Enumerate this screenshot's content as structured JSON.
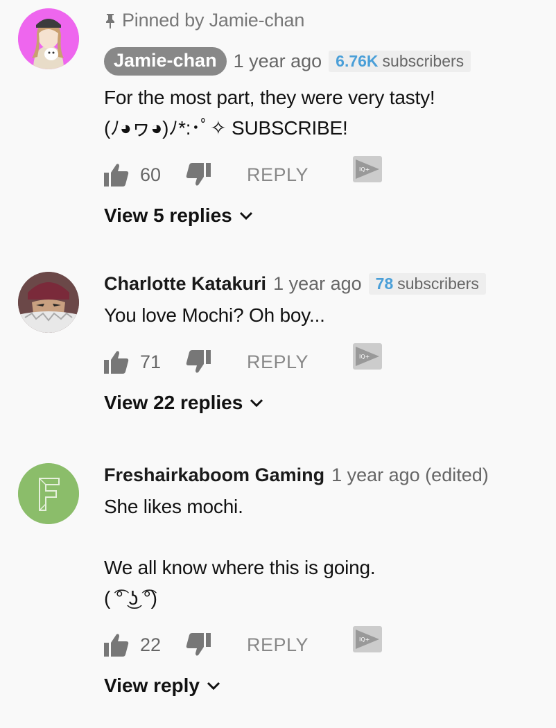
{
  "comments": [
    {
      "pinned_label": "Pinned by Jamie-chan",
      "author": "Jamie-chan",
      "time": "1 year ago",
      "subs_count": "6.76K",
      "subs_label": "subscribers",
      "lines": [
        "For the most part, they were very tasty!",
        "(ﾉ◕ヮ◕)ﾉ*:･ﾟ✧ SUBSCRIBE!"
      ],
      "likes": "60",
      "reply_label": "REPLY",
      "view_replies": "View 5 replies"
    },
    {
      "author": "Charlotte Katakuri",
      "time": "1 year ago",
      "subs_count": "78",
      "subs_label": "subscribers",
      "lines": [
        "You love Mochi? Oh boy..."
      ],
      "likes": "71",
      "reply_label": "REPLY",
      "view_replies": "View 22 replies"
    },
    {
      "author": "Freshairkaboom Gaming",
      "time": "1 year ago (edited)",
      "lines": [
        "She likes mochi.",
        "",
        "We all know where this is going.",
        "( ͡° ͜ʖ ͡°)"
      ],
      "likes": "22",
      "reply_label": "REPLY",
      "view_replies": "View reply"
    }
  ],
  "colors": {
    "background": "#f9f9f9",
    "subscriber_count": "#4a9fd8",
    "author_chip": "#888888",
    "avatar_f": "#8bbd6a",
    "avatar_jamie": "#ee66ee"
  },
  "icons": {
    "pin": "pin-icon",
    "like": "thumbs-up-icon",
    "dislike": "thumbs-down-icon",
    "iq": "iq-play-icon",
    "expand": "chevron-down-icon"
  }
}
